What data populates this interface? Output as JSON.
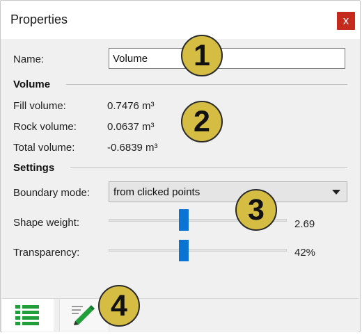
{
  "window": {
    "title": "Properties",
    "close_glyph": "x"
  },
  "name_field": {
    "label": "Name:",
    "value": "Volume"
  },
  "volume_section": {
    "title": "Volume",
    "rows": [
      {
        "label": "Fill volume:",
        "value": "0.7476 m³"
      },
      {
        "label": "Rock volume:",
        "value": "0.0637 m³"
      },
      {
        "label": "Total volume:",
        "value": "-0.6839 m³"
      }
    ]
  },
  "settings_section": {
    "title": "Settings",
    "boundary_mode": {
      "label": "Boundary mode:",
      "selected": "from clicked points"
    },
    "shape_weight": {
      "label": "Shape weight:",
      "value": "2.69"
    },
    "transparency": {
      "label": "Transparency:",
      "value": "42%"
    }
  },
  "tabs": [
    {
      "name": "properties-list",
      "icon": "list-icon",
      "active": true
    },
    {
      "name": "edit",
      "icon": "pencil-icon",
      "active": false
    }
  ],
  "callouts": [
    "1",
    "2",
    "3",
    "4"
  ],
  "colors": {
    "accent": "#0a74d4",
    "close": "#c42b1c",
    "callout": "#d4bd42",
    "tab_icon": "#1f9e3a"
  }
}
